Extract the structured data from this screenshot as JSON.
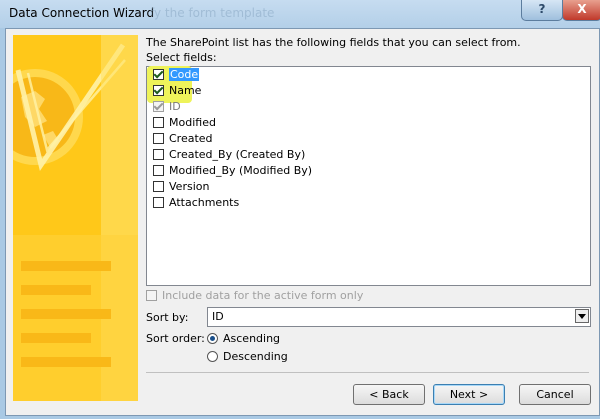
{
  "window": {
    "title": "Data Connection Wizard",
    "ghost_text": "fy the form template",
    "help": "?",
    "close": "X"
  },
  "content": {
    "intro": "The SharePoint list has the following fields that you can select from.",
    "select_fields_label": "Select fields:",
    "fields": [
      {
        "label": "Code",
        "checked": true,
        "selected": true,
        "enabled": true
      },
      {
        "label": "Name",
        "checked": true,
        "selected": false,
        "enabled": true
      },
      {
        "label": "ID",
        "checked": true,
        "selected": false,
        "enabled": false
      },
      {
        "label": "Modified",
        "checked": false,
        "selected": false,
        "enabled": true
      },
      {
        "label": "Created",
        "checked": false,
        "selected": false,
        "enabled": true
      },
      {
        "label": "Created_By (Created By)",
        "checked": false,
        "selected": false,
        "enabled": true
      },
      {
        "label": "Modified_By (Modified By)",
        "checked": false,
        "selected": false,
        "enabled": true
      },
      {
        "label": "Version",
        "checked": false,
        "selected": false,
        "enabled": true
      },
      {
        "label": "Attachments",
        "checked": false,
        "selected": false,
        "enabled": true
      }
    ],
    "include_data_label": "Include data for the active form only",
    "include_data_checked": false,
    "sort_by_label": "Sort by:",
    "sort_by_value": "ID",
    "sort_order_label": "Sort order:",
    "sort_order_options": [
      {
        "label": "Ascending",
        "selected": true
      },
      {
        "label": "Descending",
        "selected": false
      }
    ]
  },
  "buttons": {
    "back": "< Back",
    "next": "Next >",
    "cancel": "Cancel"
  },
  "colors": {
    "accent_art": "#ffc819",
    "highlight": "#eef35a",
    "selection": "#3399ff"
  }
}
